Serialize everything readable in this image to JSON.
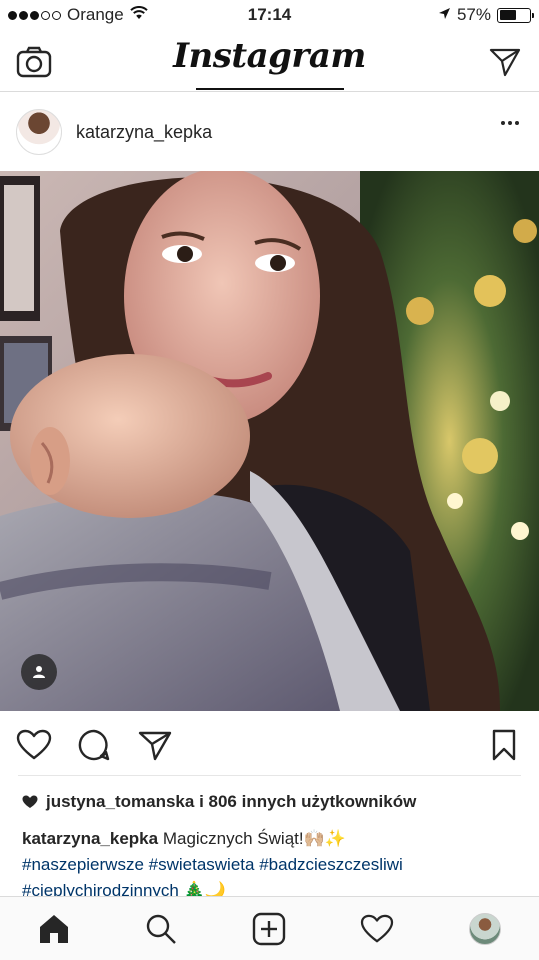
{
  "status_bar": {
    "carrier": "Orange",
    "time": "17:14",
    "battery_percent": "57%",
    "battery_level": 0.57,
    "signal_dots_full": 3,
    "signal_dots_total": 5
  },
  "header": {
    "logo_text": "Instagram",
    "left_icon": "camera-icon",
    "right_icon": "direct-send-icon"
  },
  "post": {
    "username": "katarzyna_kepka",
    "likes": {
      "first_liker": "justyna_tomanska",
      "rest": " i 806 innych użytkowników"
    },
    "caption": {
      "username": "katarzyna_kepka",
      "text": "Magicznych Świąt!🙌🏼✨",
      "hashtags_line1": [
        "#naszepierwsze",
        "#swietaswieta",
        "#badzcieszczesliwi"
      ],
      "hashtags_line2": "#cieplychirodzinnych 🎄🌙"
    }
  },
  "bottom_nav": {
    "items": [
      "home-icon",
      "search-icon",
      "add-post-icon",
      "activity-heart-icon",
      "profile-avatar"
    ]
  },
  "colors": {
    "text": "#262626",
    "hashtag": "#003569",
    "divider": "#dbdbdb"
  }
}
